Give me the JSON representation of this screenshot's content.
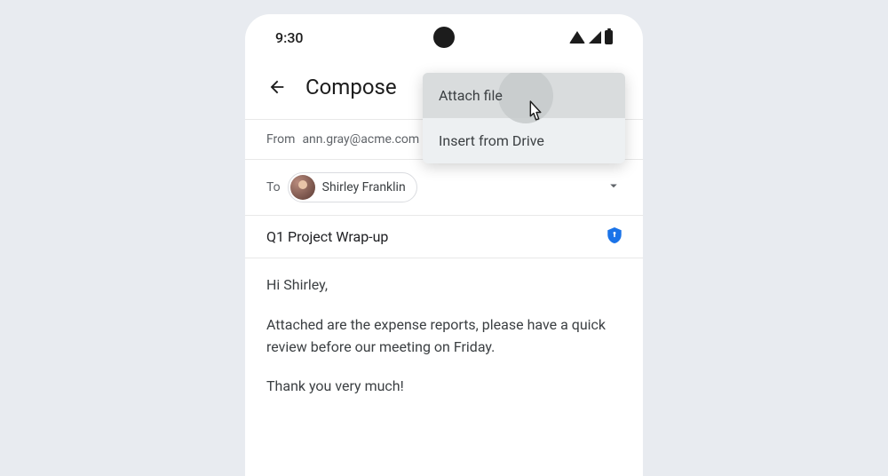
{
  "status": {
    "time": "9:30"
  },
  "header": {
    "title": "Compose"
  },
  "from": {
    "label": "From",
    "value": "ann.gray@acme.com"
  },
  "to": {
    "label": "To",
    "chip_name": "Shirley Franklin"
  },
  "subject": {
    "text": "Q1 Project Wrap-up"
  },
  "body": {
    "p1": "Hi Shirley,",
    "p2": "Attached are the expense reports, please have a quick review before our meeting on Friday.",
    "p3": "Thank you very much!"
  },
  "menu": {
    "attach_file": "Attach file",
    "insert_drive": "Insert from Drive"
  }
}
